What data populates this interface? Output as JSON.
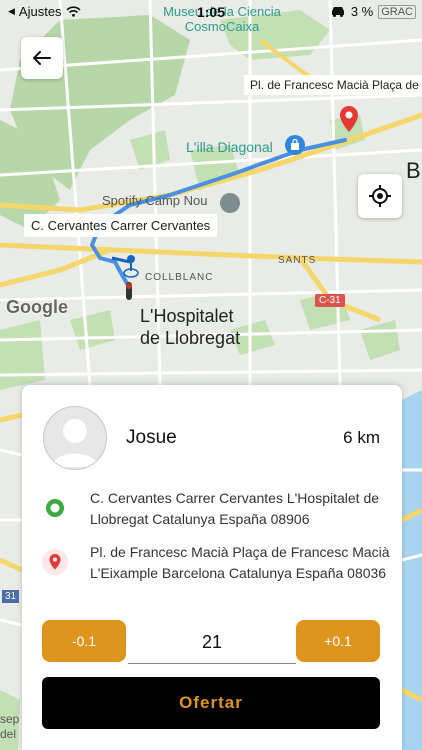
{
  "status_bar": {
    "back_app": "Ajustes",
    "time": "1:05",
    "battery": "3 %"
  },
  "map": {
    "labels": {
      "museum_line1": "Museu de la Ciencia",
      "museum_line2": "CosmoCaixa",
      "illa": "L'illa Diagonal",
      "camp_nou": "Spotify Camp Nou",
      "collblanc": "COLLBLANC",
      "sants": "SANTS",
      "hospitalet_line1": "L'Hospitalet",
      "hospitalet_line2": "de Llobregat",
      "google": "Google",
      "c31": "C-31",
      "edge_b": "B",
      "edge_31": "31",
      "edge_corner": "GRAC",
      "edge_sep": "sep",
      "edge_del": "del"
    },
    "origin_label": "C. Cervantes Carrer Cervantes",
    "destination_label": "Pl. de Francesc Macià Plaça de",
    "route_color": "#4a90e2",
    "marker_color": "#e53935"
  },
  "trip": {
    "driver_name": "Josue",
    "distance": "6 km",
    "origin_address": "C. Cervantes Carrer Cervantes  L'Hospitalet de Llobregat Catalunya España 08906",
    "destination_address": "Pl. de Francesc Macià Plaça de Francesc Macià L'Eixample Barcelona Catalunya España 08036",
    "decrease_label": "-0.1",
    "price_value": "21",
    "increase_label": "+0.1",
    "submit_label": "Ofertar",
    "accent_color": "#dd951d",
    "origin_icon_color": "#3da940",
    "destination_icon_color": "#e53935"
  }
}
